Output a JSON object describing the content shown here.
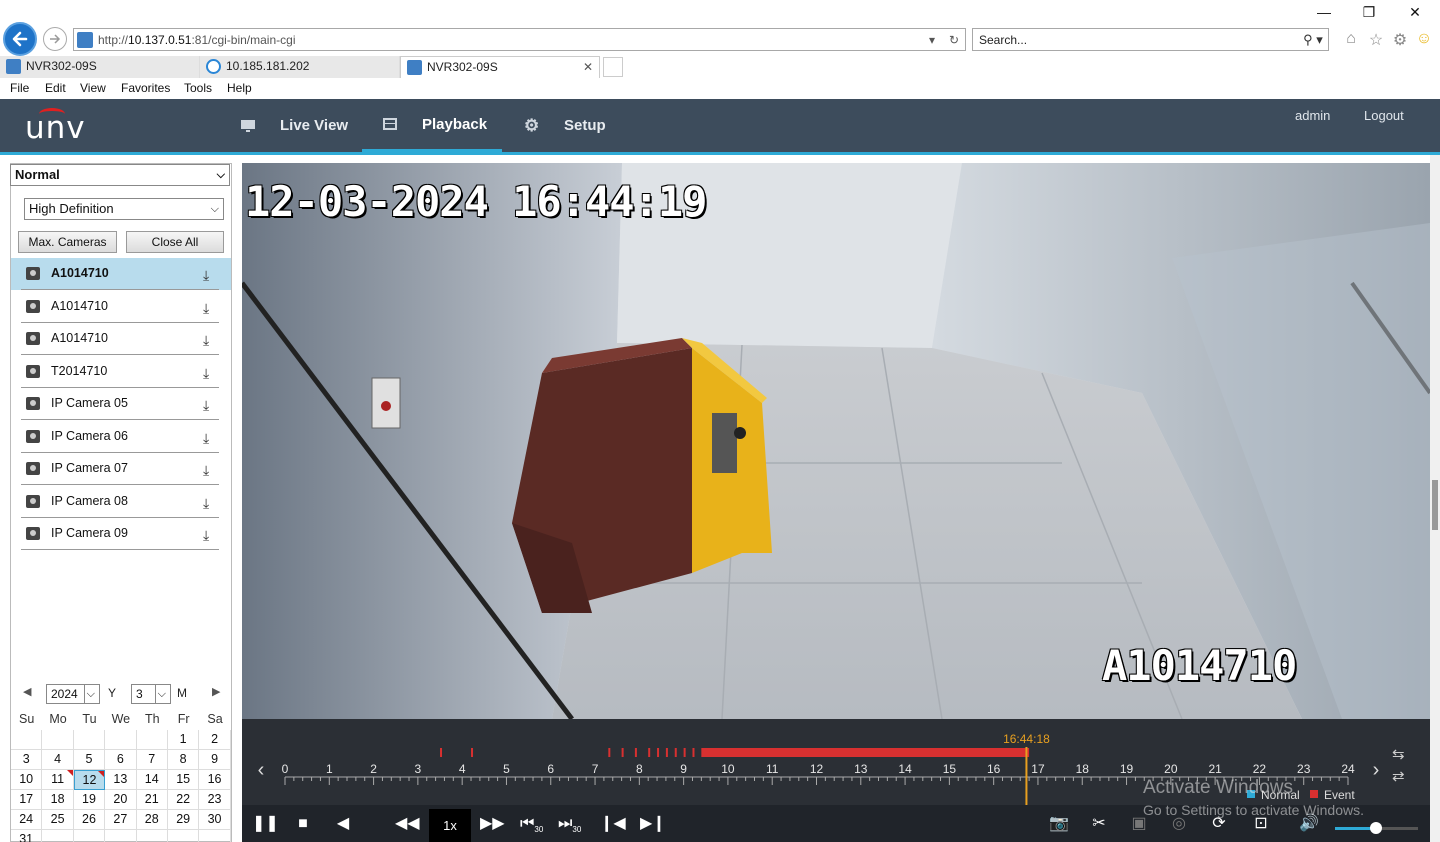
{
  "browser": {
    "address": {
      "prefix": "http://",
      "host": "10.137.0.51",
      "rest": ":81/cgi-bin/main-cgi"
    },
    "search_placeholder": "Search...",
    "tabs": [
      {
        "label": "NVR302-09S",
        "active": false
      },
      {
        "label": "10.185.181.202",
        "active": false
      },
      {
        "label": "NVR302-09S",
        "active": true
      }
    ],
    "menu": [
      "File",
      "Edit",
      "View",
      "Favorites",
      "Tools",
      "Help"
    ]
  },
  "app": {
    "logo": "unv",
    "nav": [
      {
        "label": "Live View",
        "icon": "monitor-icon",
        "active": false
      },
      {
        "label": "Playback",
        "icon": "film-icon",
        "active": true
      },
      {
        "label": "Setup",
        "icon": "gear-icon",
        "active": false
      }
    ],
    "user": "admin",
    "logout": "Logout",
    "accent": "#2eaad6",
    "header_bg": "#3d4c5c"
  },
  "left_panel": {
    "mode": "Normal",
    "quality": "High Definition",
    "max_cameras": "Max. Cameras",
    "close_all": "Close All",
    "cameras": [
      {
        "name": "A1014710",
        "selected": true
      },
      {
        "name": "A1014710",
        "selected": false
      },
      {
        "name": "A1014710",
        "selected": false
      },
      {
        "name": "T2014710",
        "selected": false
      },
      {
        "name": "IP Camera 05",
        "selected": false
      },
      {
        "name": "IP Camera 06",
        "selected": false
      },
      {
        "name": "IP Camera 07",
        "selected": false
      },
      {
        "name": "IP Camera 08",
        "selected": false
      },
      {
        "name": "IP Camera 09",
        "selected": false
      }
    ],
    "calendar": {
      "year": "2024",
      "year_label": "Y",
      "month": "3",
      "month_label": "M",
      "weekdays": [
        "Su",
        "Mo",
        "Tu",
        "We",
        "Th",
        "Fr",
        "Sa"
      ],
      "weeks": [
        [
          "",
          "",
          "",
          "",
          "",
          "1",
          "2"
        ],
        [
          "3",
          "4",
          "5",
          "6",
          "7",
          "8",
          "9"
        ],
        [
          "10",
          "11",
          "12",
          "13",
          "14",
          "15",
          "16"
        ],
        [
          "17",
          "18",
          "19",
          "20",
          "21",
          "22",
          "23"
        ],
        [
          "24",
          "25",
          "26",
          "27",
          "28",
          "29",
          "30"
        ],
        [
          "31",
          "",
          "",
          "",
          "",
          "",
          ""
        ]
      ],
      "today": "12",
      "recorded_days": [
        "11",
        "12"
      ]
    }
  },
  "video": {
    "osd_timestamp": "12-03-2024 16:44:19",
    "osd_camera": "A1014710"
  },
  "timeline": {
    "cursor_time": "16:44:18",
    "cursor_hour": 16.74,
    "hours": [
      "0",
      "1",
      "2",
      "3",
      "4",
      "5",
      "6",
      "7",
      "8",
      "9",
      "10",
      "11",
      "12",
      "13",
      "14",
      "15",
      "16",
      "17",
      "18",
      "19",
      "20",
      "21",
      "22",
      "23",
      "24"
    ],
    "legend_normal": "Normal",
    "legend_event": "Event",
    "normal_color": "#2eaad6",
    "event_color": "#d83030",
    "event_segments_hours": [
      [
        9.4,
        16.8
      ]
    ]
  },
  "controls": {
    "speed": "1x",
    "skip_back_label": "30",
    "skip_fwd_label": "30"
  },
  "watermark": {
    "line1": "Activate Windows",
    "line2": "Go to Settings to activate Windows."
  }
}
